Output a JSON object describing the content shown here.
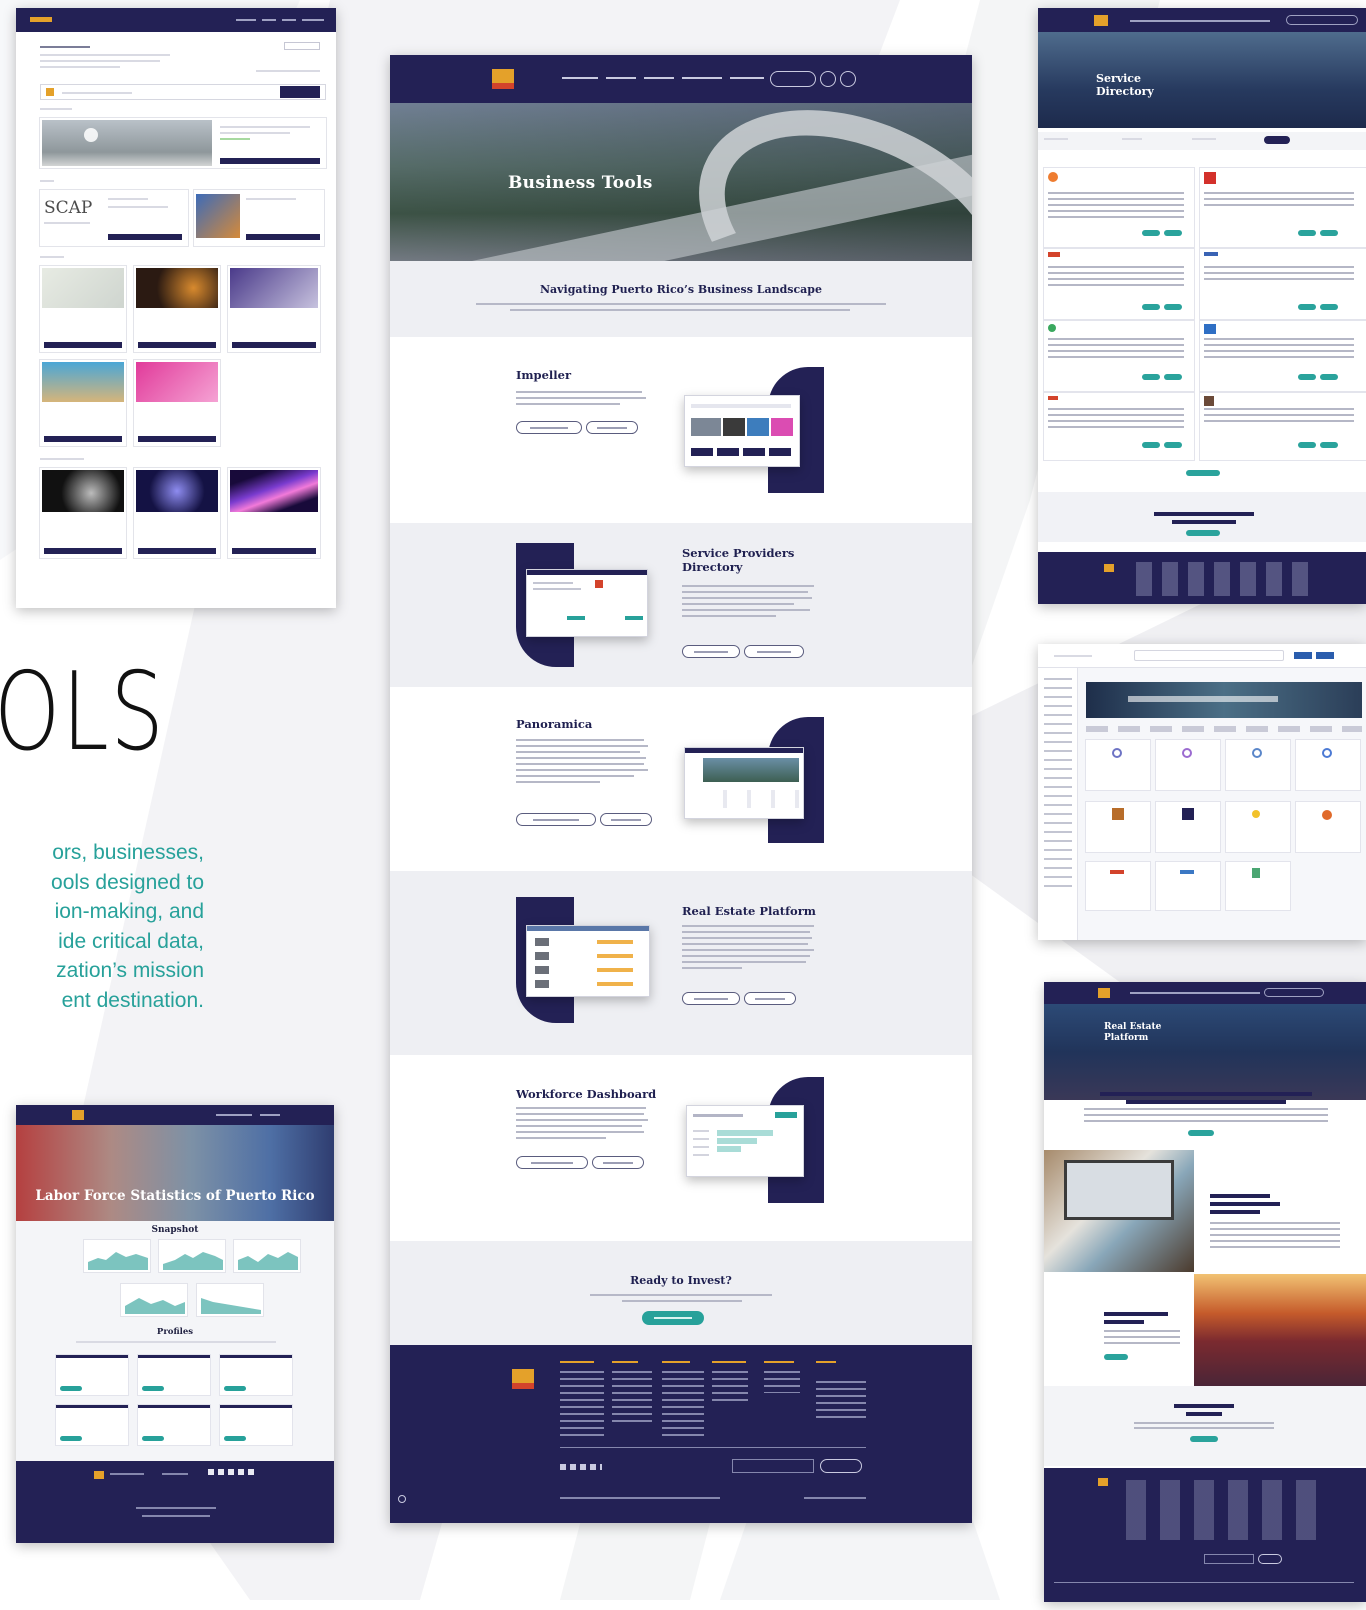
{
  "colors": {
    "navy": "#232155",
    "teal_text": "#27a19a",
    "gold": "#e4a12a",
    "accent_red": "#d3432b",
    "section_grey": "#eeeff3"
  },
  "intro": {
    "tools_word": "OLS",
    "lines": [
      "ors, businesses,",
      "ools designed to",
      "ion-making, and",
      "ide critical data,",
      "zation’s mission",
      "ent destination."
    ]
  },
  "main_page": {
    "hero_title": "Business Tools",
    "intro_heading": "Navigating Puerto Rico’s Business Landscape",
    "tools": [
      {
        "title": "Impeller"
      },
      {
        "title_line1": "Service Providers",
        "title_line2": "Directory"
      },
      {
        "title": "Panoramica"
      },
      {
        "title": "Real Estate Platform"
      },
      {
        "title": "Workforce Dashboard"
      }
    ],
    "cta_heading": "Ready to Invest?"
  },
  "left_top_screen": {
    "scap_text": "SCAP"
  },
  "labor_force_screen": {
    "hero_title": "Labor Force Statistics of Puerto Rico",
    "snapshot_heading": "Snapshot",
    "profiles_heading": "Profiles"
  },
  "right_top_screen": {
    "hero_line1": "Service",
    "hero_line2": "Directory"
  },
  "right_bottom_screen": {
    "hero_line1": "Real Estate",
    "hero_line2": "Platform"
  },
  "icons": {
    "logo": "brand-logo-icon",
    "search": "search-icon",
    "globe": "globe-icon",
    "play": "play-icon"
  }
}
